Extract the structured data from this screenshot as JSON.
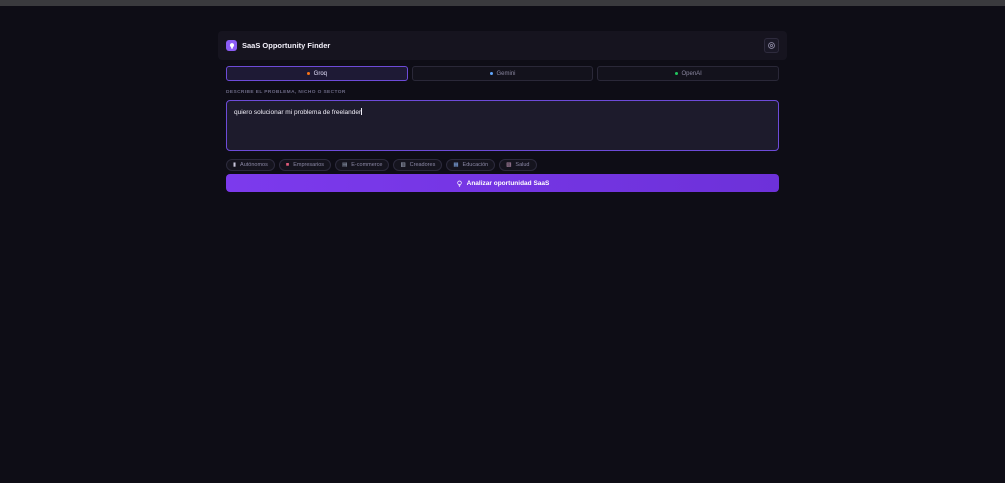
{
  "app": {
    "title": "SaaS Opportunity Finder"
  },
  "providers": [
    {
      "label": "Groq",
      "color": "#f97316",
      "active": true
    },
    {
      "label": "Gemini",
      "color": "#60a5fa",
      "active": false
    },
    {
      "label": "OpenAI",
      "color": "#22c55e",
      "active": false
    }
  ],
  "prompt": {
    "label": "DESCRIBE EL PROBLEMA, NICHO O SECTOR",
    "value": "quiero solucionar mi problema de freelander"
  },
  "tags": [
    {
      "icon": "▮",
      "label": "Autónomos"
    },
    {
      "icon": "■",
      "label": "Empresarios"
    },
    {
      "icon": "▤",
      "label": "E-commerce"
    },
    {
      "icon": "▥",
      "label": "Creadores"
    },
    {
      "icon": "▦",
      "label": "Educación"
    },
    {
      "icon": "▧",
      "label": "Salud"
    }
  ],
  "analyze_button": {
    "label": "Analizar oportunidad SaaS"
  },
  "colors": {
    "accent": "#7c3aed",
    "background": "#0e0d16"
  }
}
